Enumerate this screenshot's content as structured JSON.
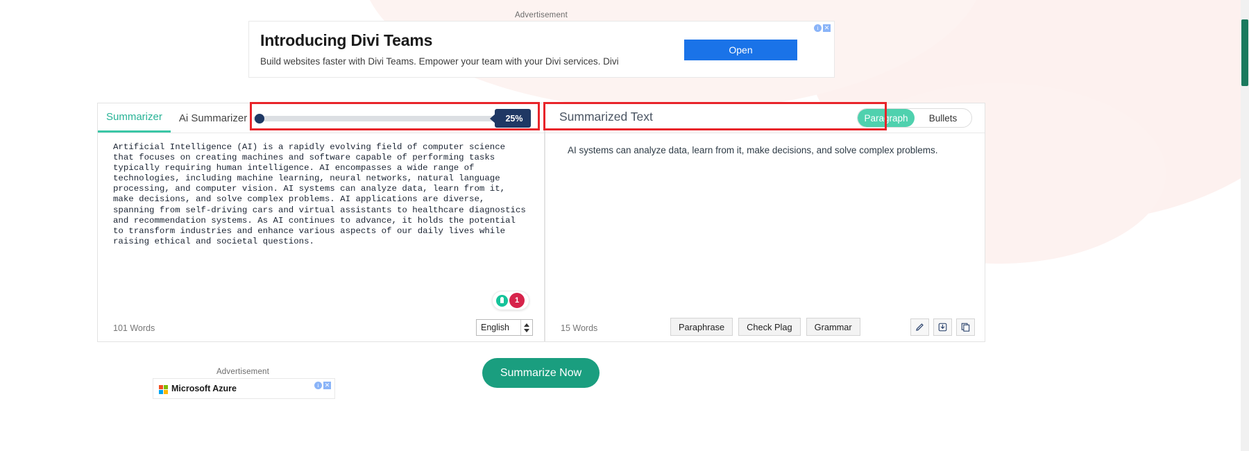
{
  "ads": {
    "label": "Advertisement",
    "top": {
      "title": "Introducing Divi Teams",
      "subtitle": "Build websites faster with Divi Teams. Empower your team with your Divi services. Divi",
      "cta": "Open",
      "info_glyph": "i",
      "close_glyph": "✕"
    },
    "bottom": {
      "label": "Advertisement",
      "title": "Microsoft Azure",
      "info_glyph": "i",
      "close_glyph": "✕"
    }
  },
  "left_panel": {
    "tabs": [
      {
        "label": "Summarizer",
        "active": true
      },
      {
        "label": "Ai Summarizer",
        "active": false
      }
    ],
    "slider": {
      "value_label": "25%",
      "value": 25,
      "min": 0,
      "max": 100
    },
    "input_text": "Artificial Intelligence (AI) is a rapidly evolving field of computer science that focuses on creating machines and software capable of performing tasks typically requiring human intelligence. AI encompasses a wide range of technologies, including machine learning, neural networks, natural language processing, and computer vision. AI systems can analyze data, learn from it, make decisions, and solve complex problems. AI applications are diverse, spanning from self-driving cars and virtual assistants to healthcare diagnostics and recommendation systems. As AI continues to advance, it holds the potential to transform industries and enhance various aspects of our daily lives while raising ethical and societal questions.",
    "word_count": "101 Words",
    "language": "English",
    "assistant_badge": {
      "bulb_icon": "lightbulb-icon",
      "error_count": "1",
      "plus_glyph": "+"
    }
  },
  "right_panel": {
    "title": "Summarized Text",
    "view_toggle": [
      {
        "label": "Paragraph",
        "active": true
      },
      {
        "label": "Bullets",
        "active": false
      }
    ],
    "summary_text": "AI systems can analyze data, learn from it, make decisions, and solve complex problems.",
    "word_count": "15 Words",
    "actions": [
      {
        "label": "Paraphrase"
      },
      {
        "label": "Check Plag"
      },
      {
        "label": "Grammar"
      }
    ],
    "icon_buttons": [
      {
        "name": "edit-pen-icon",
        "glyph": "✎"
      },
      {
        "name": "download-icon",
        "glyph": "⤓"
      },
      {
        "name": "copy-icon",
        "glyph": "❐"
      }
    ]
  },
  "summarize_button": {
    "label": "Summarize Now"
  },
  "colors": {
    "accent_teal": "#3ac7a6",
    "primary_green": "#1a9e7f",
    "badge_navy": "#1f3864",
    "annotation_red": "#e8242a",
    "ad_blue": "#1a73e8"
  }
}
